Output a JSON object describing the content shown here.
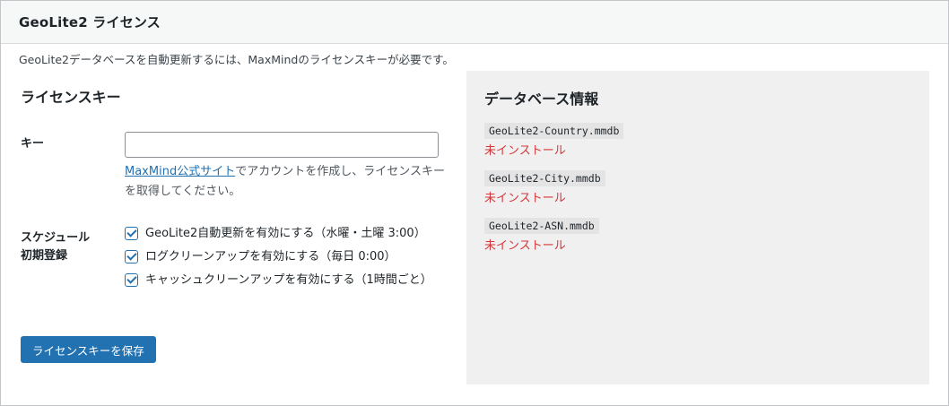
{
  "panel": {
    "title": "GeoLite2 ライセンス",
    "description": "GeoLite2データベースを自動更新するには、MaxMindのライセンスキーが必要です。"
  },
  "license": {
    "heading": "ライセンスキー",
    "key_label": "キー",
    "key_value": "",
    "help_link": "MaxMind公式サイト",
    "help_text": "でアカウントを作成し、ライセンスキーを取得してください。"
  },
  "schedule": {
    "label_line1": "スケジュール",
    "label_line2": "初期登録",
    "options": [
      {
        "label": "GeoLite2自動更新を有効にする（水曜・土曜 3:00）",
        "checked": true
      },
      {
        "label": "ログクリーンアップを有効にする（毎日 0:00）",
        "checked": true
      },
      {
        "label": "キャッシュクリーンアップを有効にする（1時間ごと）",
        "checked": true
      }
    ]
  },
  "save_button": "ライセンスキーを保存",
  "database_info": {
    "heading": "データベース情報",
    "items": [
      {
        "file": "GeoLite2-Country.mmdb",
        "status": "未インストール"
      },
      {
        "file": "GeoLite2-City.mmdb",
        "status": "未インストール"
      },
      {
        "file": "GeoLite2-ASN.mmdb",
        "status": "未インストール"
      }
    ]
  },
  "colors": {
    "primary": "#2271b1",
    "error": "#d63638",
    "panel_bg": "#f0f0f1"
  }
}
